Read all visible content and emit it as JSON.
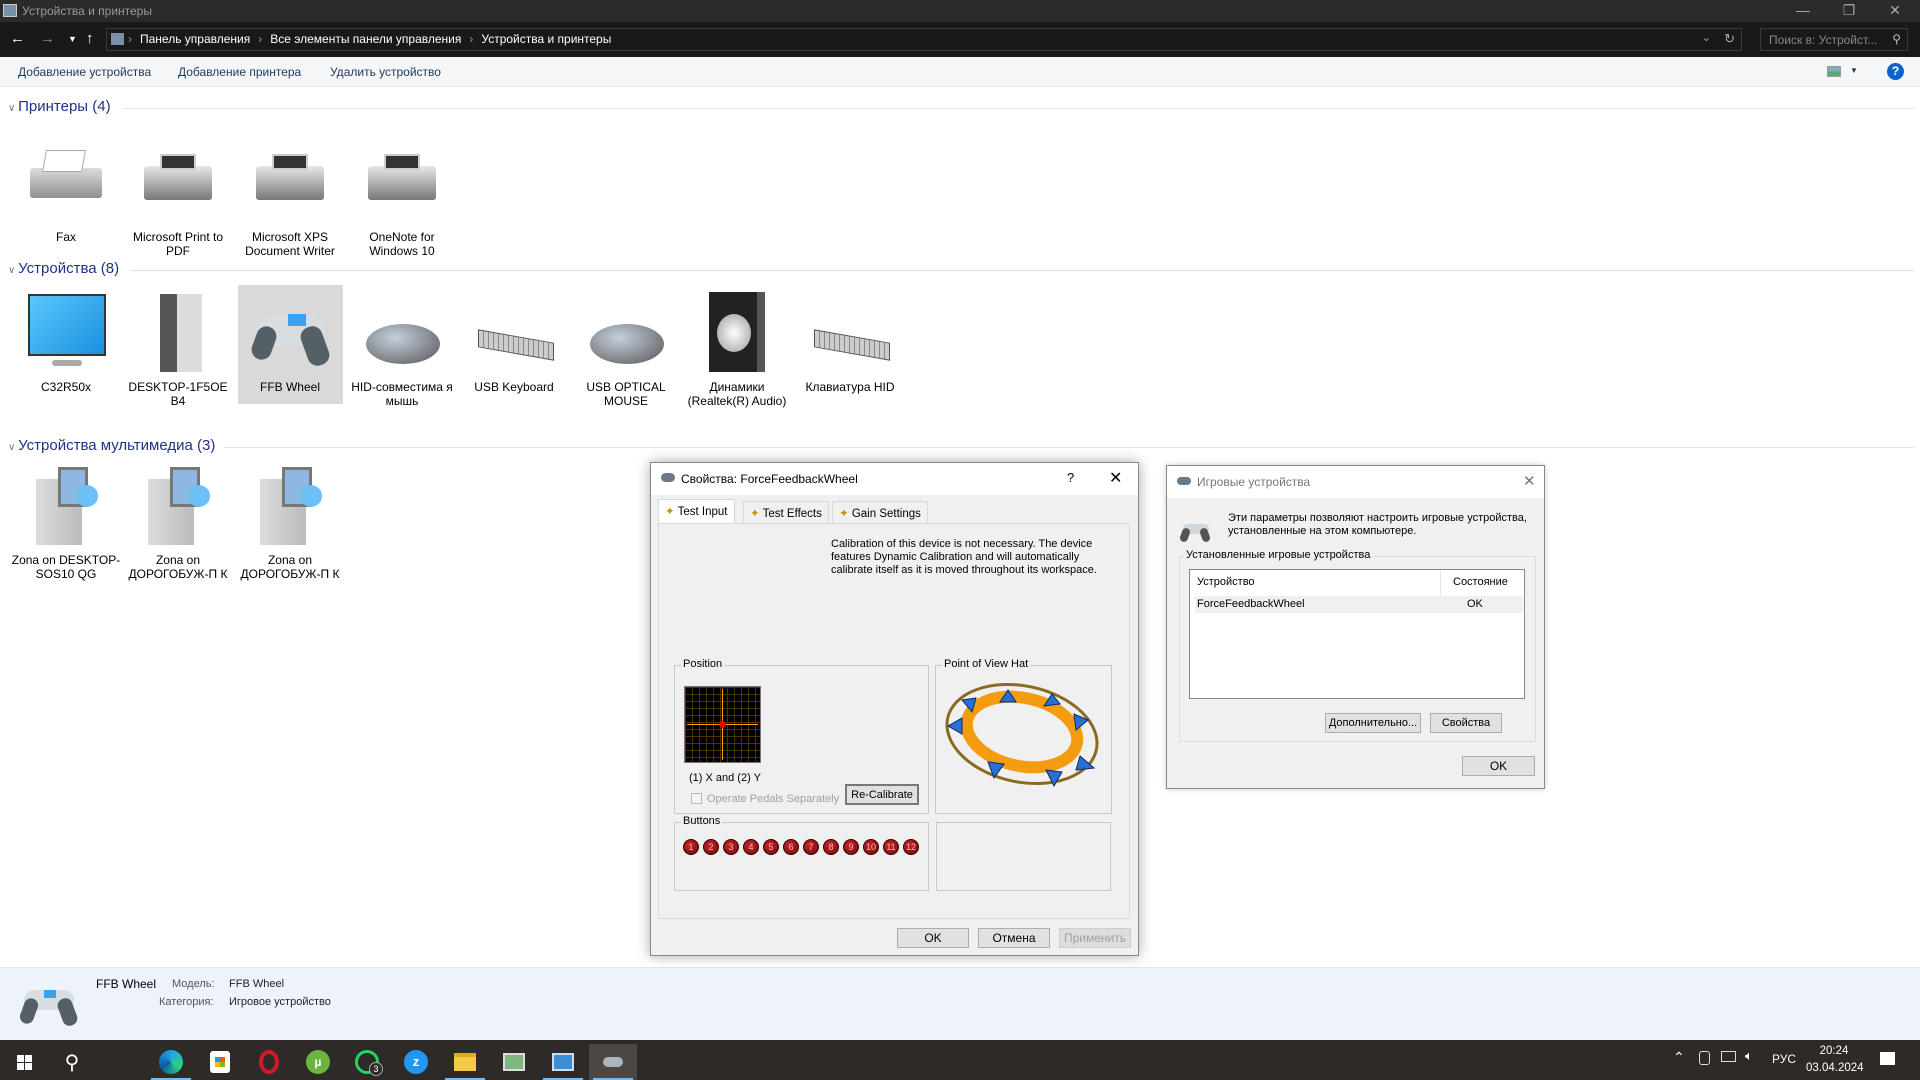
{
  "window": {
    "title": "Устройства и принтеры"
  },
  "address": {
    "crumbs": [
      "Панель управления",
      "Все элементы панели управления",
      "Устройства и принтеры"
    ],
    "search_placeholder": "Поиск в: Устройст..."
  },
  "commands": [
    "Добавление устройства",
    "Добавление принтера",
    "Удалить устройство"
  ],
  "groups": {
    "printers": {
      "title": "Принтеры (4)",
      "items": [
        "Fax",
        "Microsoft Print to PDF",
        "Microsoft XPS Document Writer",
        "OneNote for Windows 10"
      ]
    },
    "devices": {
      "title": "Устройства (8)",
      "items": [
        "C32R50x",
        "DESKTOP-1F5OE B4",
        "FFB Wheel",
        "HID-совместима я мышь",
        "USB Keyboard",
        "USB OPTICAL MOUSE",
        "Динамики (Realtek(R) Audio)",
        "Клавиатура HID"
      ],
      "selected": "FFB Wheel"
    },
    "multimedia": {
      "title": "Устройства мультимедиа (3)",
      "items": [
        "Zona on DESKTOP-SOS10 QG",
        "Zona on ДОРОГОБУЖ-П К",
        "Zona on ДОРОГОБУЖ-П К"
      ]
    }
  },
  "details": {
    "name": "FFB Wheel",
    "model_label": "Модель:",
    "model": "FFB Wheel",
    "category_label": "Категория:",
    "category": "Игровое устройство"
  },
  "props_dialog": {
    "title": "Свойства: ForceFeedbackWheel",
    "help": "?",
    "tabs": [
      "Test Input",
      "Test Effects",
      "Gain Settings"
    ],
    "calibration_text": "Calibration of this device is not necessary. The device features Dynamic Calibration and will automatically calibrate itself as it is moved throughout its workspace.",
    "position_label": "Position",
    "axes_label": "(1) X and (2) Y",
    "pedals_label": "Operate Pedals Separately",
    "pedals_checked": false,
    "recalibrate": "Re-Calibrate",
    "pov_label": "Point of View Hat",
    "buttons_label": "Buttons",
    "buttons": [
      "1",
      "2",
      "3",
      "4",
      "5",
      "6",
      "7",
      "8",
      "9",
      "10",
      "11",
      "12"
    ],
    "ok": "OK",
    "cancel": "Отмена",
    "apply": "Применить"
  },
  "game_dialog": {
    "title": "Игровые устройства",
    "description": "Эти параметры позволяют настроить игровые устройства, установленные на этом компьютере.",
    "group_label": "Установленные игровые устройства",
    "columns": [
      "Устройство",
      "Состояние"
    ],
    "rows": [
      {
        "device": "ForceFeedbackWheel",
        "status": "OK"
      }
    ],
    "advanced": "Дополнительно...",
    "properties": "Свойства",
    "ok": "OK"
  },
  "taskbar": {
    "apps": [
      "edge",
      "store",
      "opera",
      "utorrent",
      "whatsapp",
      "zoom",
      "explorer",
      "money-app",
      "control-panel",
      "game-controllers"
    ],
    "whatsapp_badge": "3",
    "lang": "РУС",
    "time": "20:24",
    "date": "03.04.2024"
  },
  "colors": {
    "accent": "#1e3287",
    "titlebar": "#2b2b2b",
    "taskbar": "#2d2a27"
  }
}
